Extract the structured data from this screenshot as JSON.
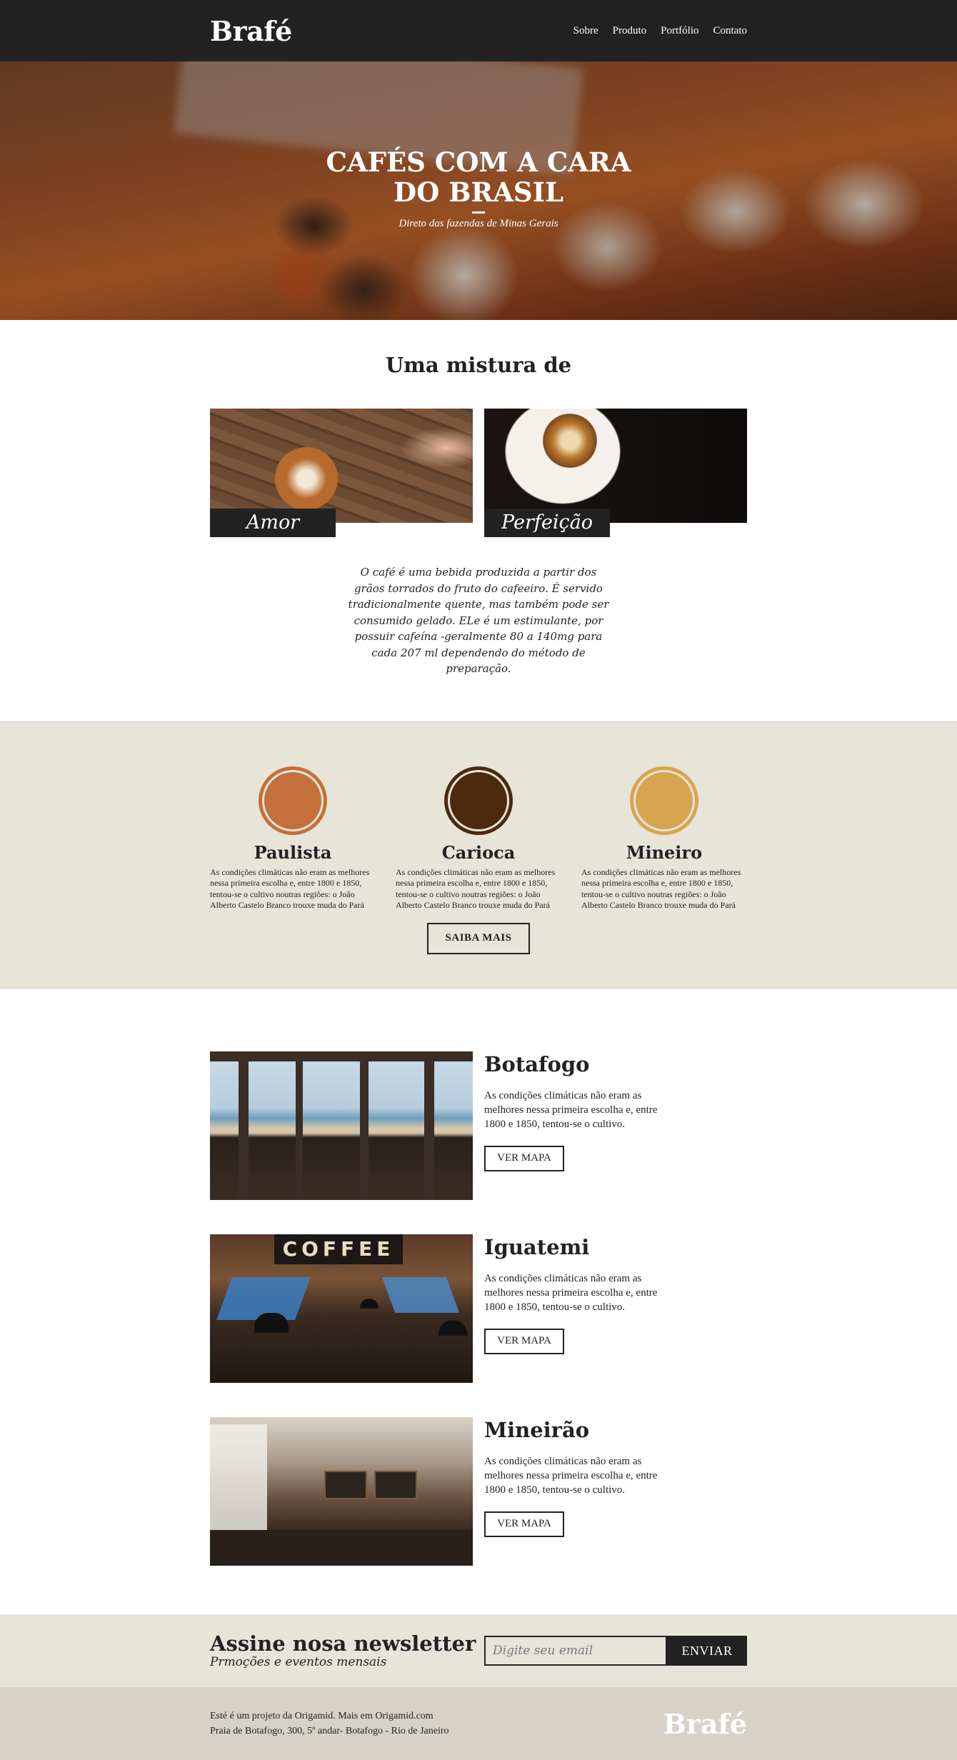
{
  "header": {
    "logo": "Brafé",
    "nav": [
      "Sobre",
      "Produto",
      "Portfólio",
      "Contato"
    ]
  },
  "hero": {
    "title": "CAFÉS COM A CARA DO BRASIL",
    "subtitle": "Direto das fazendas de Minas Gerais"
  },
  "mistura": {
    "title": "Uma mistura de",
    "cards": [
      {
        "label": "Amor"
      },
      {
        "label": "Perfeição"
      }
    ],
    "text": "O café é uma bebida produzida a partir dos grãos torrados do fruto do cafeeiro. É servido tradicionalmente quente, mas também pode ser consumido gelado. ELe é um estimulante, por possuir cafeína -geralmente 80 a 140mg para cada 207 ml dependendo do método de preparação."
  },
  "blends": {
    "items": [
      {
        "name": "Paulista",
        "color": "#c4703a",
        "desc": "As condições climáticas não eram as melhores nessa primeira escolha e, entre 1800 e 1850, tentou-se o cultivo noutras regiões: o João Alberto Castelo Branco trouxe muda do Pará"
      },
      {
        "name": "Carioca",
        "color": "#4b2a10",
        "desc": "As condições climáticas não eram as melhores nessa primeira escolha e, entre 1800 e 1850, tentou-se o cultivo noutras regiões: o João Alberto Castelo Branco trouxe muda do Pará"
      },
      {
        "name": "Mineiro",
        "color": "#d7a54f",
        "desc": "As condições climáticas não eram as melhores nessa primeira escolha e, entre 1800 e 1850, tentou-se o cultivo noutras regiões: o João Alberto Castelo Branco trouxe muda do Pará"
      }
    ],
    "button": "SAIBA MAIS"
  },
  "locais": [
    {
      "name": "Botafogo",
      "desc": "As condições climáticas não eram as melhores nessa primeira escolha e, entre 1800 e 1850, tentou-se o cultivo.",
      "button": "VER MAPA"
    },
    {
      "name": "Iguatemi",
      "desc": "As condições climáticas não eram as melhores nessa primeira escolha e, entre 1800 e 1850, tentou-se o cultivo.",
      "button": "VER MAPA",
      "sign": "COFFEE"
    },
    {
      "name": "Mineirão",
      "desc": "As condições climáticas não eram as melhores nessa primeira escolha e, entre 1800 e 1850, tentou-se o cultivo.",
      "button": "VER MAPA"
    }
  ],
  "newsletter": {
    "title": "Assine nosa newsletter",
    "subtitle": "Prmoções e eventos mensais",
    "placeholder": "Digite seu email",
    "button": "ENVIAR"
  },
  "footer": {
    "line1": "Esté é um projeto da Origamid. Mais em Origamid.com",
    "line2": "Praia de Botafogo, 300, 5º andar- Botafogo - Rio de Janeiro",
    "logo": "Brafé"
  }
}
